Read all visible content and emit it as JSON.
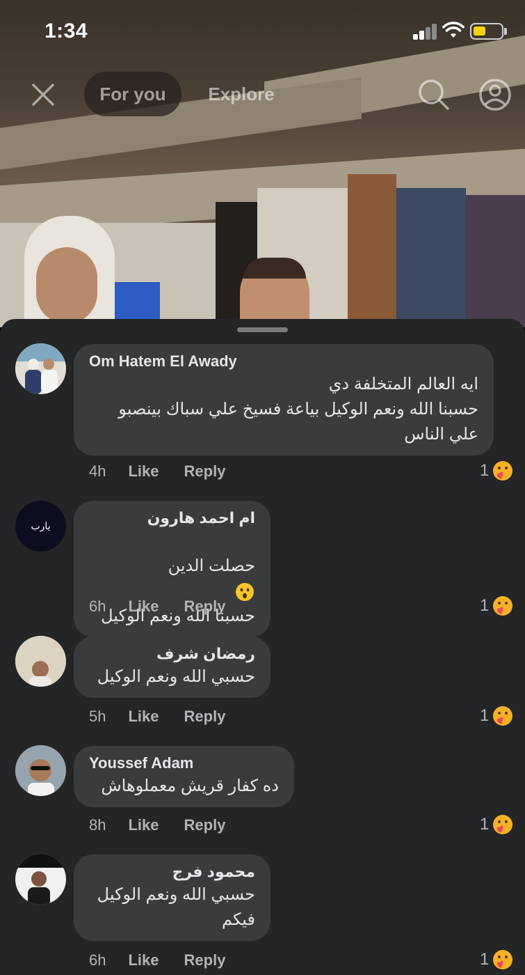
{
  "status_bar": {
    "time": "1:34"
  },
  "nav": {
    "tabs": [
      {
        "label": "For you",
        "active": true
      },
      {
        "label": "Explore",
        "active": false
      }
    ],
    "icons": [
      "close-icon",
      "search-icon",
      "profile-icon"
    ]
  },
  "comments": [
    {
      "author": "Om Hatem El Awady",
      "lines": [
        "ايه العالم المتخلفة دي",
        "حسبنا الله ونعم الوكيل بياعة فسيخ علي سباك بينصبو",
        "علي الناس"
      ],
      "time": "4h",
      "like": "Like",
      "reply": "Reply",
      "reaction_count": "1"
    },
    {
      "author": "ام احمد هارون",
      "lines": [
        "حصلت الدين",
        "حسبنا الله ونعم الوكيل"
      ],
      "time": "6h",
      "like": "Like",
      "reply": "Reply",
      "reaction_count": "1",
      "avatar_text": "يارب"
    },
    {
      "author": "رمضان شرف",
      "lines": [
        "حسبي الله ونعم الوكيل"
      ],
      "time": "5h",
      "like": "Like",
      "reply": "Reply",
      "reaction_count": "1"
    },
    {
      "author": "Youssef Adam",
      "lines": [
        "ده كفار قريش معملوهاش"
      ],
      "time": "8h",
      "like": "Like",
      "reply": "Reply",
      "reaction_count": "1"
    },
    {
      "author": "محمود فرج",
      "lines": [
        "حسبي الله ونعم الوكيل",
        "فيكم"
      ],
      "time": "6h",
      "like": "Like",
      "reply": "Reply",
      "reaction_count": "1"
    }
  ],
  "colors": {
    "sheet_bg": "#242526",
    "bubble_bg": "#3a3b3c",
    "text_primary": "#e4e6eb",
    "text_secondary": "#b0b3b8",
    "battery": "#f5d20a"
  }
}
